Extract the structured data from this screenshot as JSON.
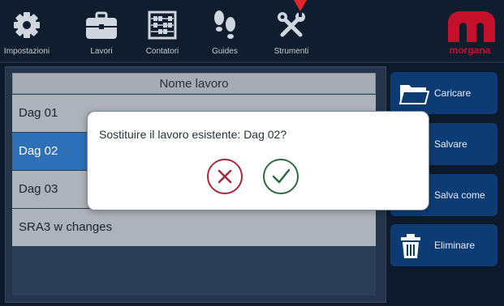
{
  "nav": {
    "items": [
      {
        "label": "Impostazioni",
        "icon": "gear-icon"
      },
      {
        "label": "Lavori",
        "icon": "briefcase-icon"
      },
      {
        "label": "Contatori",
        "icon": "abacus-icon"
      },
      {
        "label": "Guides",
        "icon": "footprints-icon"
      },
      {
        "label": "Strumenti",
        "icon": "tools-icon"
      }
    ]
  },
  "brand": {
    "name": "morgana",
    "color": "#c5102b"
  },
  "list": {
    "header": "Nome lavoro",
    "rows": [
      {
        "name": "Dag 01",
        "selected": false
      },
      {
        "name": "Dag 02",
        "selected": true
      },
      {
        "name": "Dag 03",
        "selected": false
      },
      {
        "name": "SRA3 w changes",
        "selected": false
      }
    ]
  },
  "actions": [
    {
      "label": "Caricare",
      "icon": "folder-icon"
    },
    {
      "label": "Salvare",
      "icon": "save-icon"
    },
    {
      "label": "Salva come",
      "icon": "save-as-icon"
    },
    {
      "label": "Eliminare",
      "icon": "trash-icon"
    }
  ],
  "dialog": {
    "message": "Sostituire il lavoro esistente: Dag 02?",
    "cancel_icon": "close-icon",
    "confirm_icon": "check-icon"
  },
  "colors": {
    "selection": "#2e70b7",
    "panel": "#0d3c75",
    "accent_red": "#a42a3a",
    "accent_green": "#2d6a3f"
  }
}
